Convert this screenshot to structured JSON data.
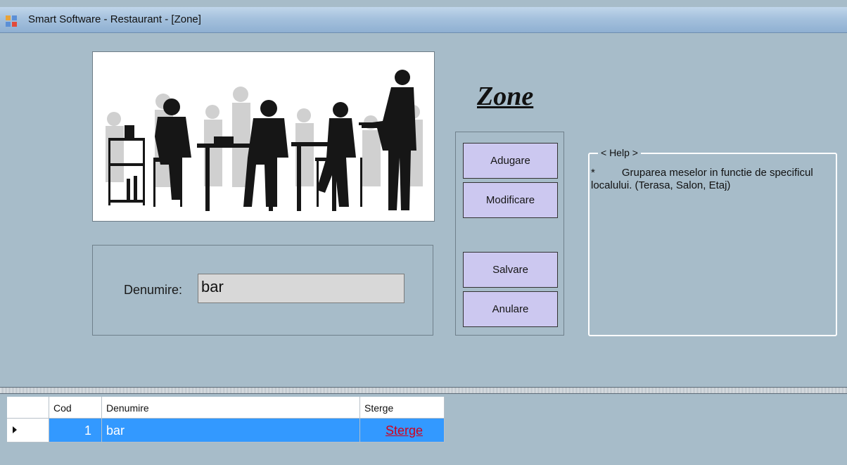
{
  "window": {
    "title": "Smart Software - Restaurant - [Zone]"
  },
  "form": {
    "heading": "Zone",
    "field_label": "Denumire:",
    "field_value": "bar"
  },
  "buttons": {
    "add": "Adugare",
    "modify": "Modificare",
    "save": "Salvare",
    "cancel": "Anulare"
  },
  "help": {
    "legend": "< Help >",
    "bullet": "*",
    "text": "Gruparea meselor in functie de specificul localului. (Terasa, Salon, Etaj)"
  },
  "grid": {
    "headers": {
      "cod": "Cod",
      "denumire": "Denumire",
      "sterge": "Sterge"
    },
    "rows": [
      {
        "cod": "1",
        "denumire": "bar",
        "sterge": "Sterge"
      }
    ]
  },
  "colors": {
    "background": "#a7bcc9",
    "button": "#ccc8f0",
    "selection": "#3399ff",
    "link": "#d2001c"
  }
}
